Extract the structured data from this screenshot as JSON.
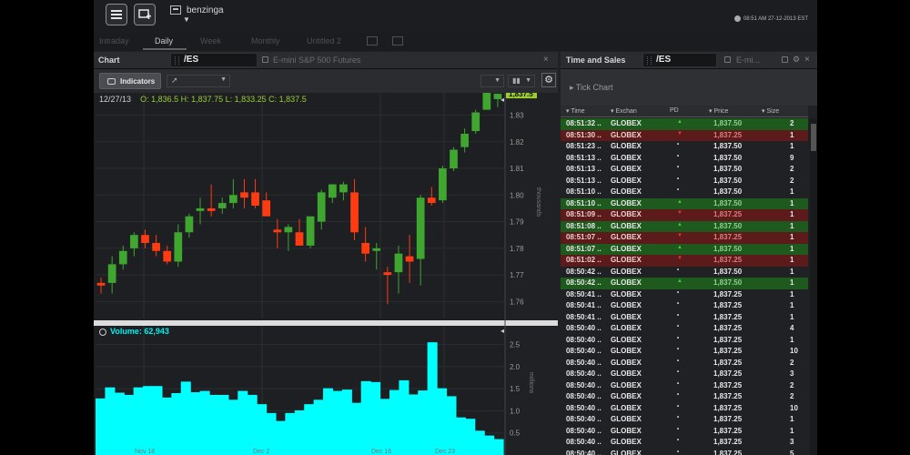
{
  "topbar": {
    "workspace_name": "benzinga",
    "clock": "08:51 AM 27-12-2013 EST"
  },
  "tabs": [
    {
      "label": "Intraday",
      "active": false
    },
    {
      "label": "Daily",
      "active": true
    },
    {
      "label": "Week",
      "active": false
    },
    {
      "label": "Monthly",
      "active": false
    },
    {
      "label": "Untitled 2",
      "active": false
    }
  ],
  "chart_panel": {
    "title": "Chart",
    "symbol": "/ES",
    "description": "E-mini S&P 500 Futures",
    "indicators_label": "Indicators",
    "ohlc_date": "12/27/13",
    "ohlc": "O: 1,836.5 H: 1,837.75 L: 1,833.25 C: 1,837.5",
    "last_price_tag": "1,837.5",
    "volume_label": "Volume:",
    "volume_value": "62,943",
    "price_axis_title": "thousands",
    "volume_axis_title": "millions",
    "x_labels": [
      "Nov 18",
      "Dec 2",
      "Dec 16",
      "Dec 23"
    ]
  },
  "ts_panel": {
    "title": "Time and Sales",
    "symbol": "/ES",
    "description": "E-mi...",
    "tick_chart_label": "Tick Chart",
    "columns": {
      "time": "Time",
      "exch": "Exchan",
      "pd": "PD",
      "price": "Price",
      "size": "Size"
    },
    "rows": [
      {
        "time": "08:51:32 ..",
        "exch": "GLOBEX",
        "pd": "up",
        "price": "1,837.50",
        "size": "2",
        "hl": "g"
      },
      {
        "time": "08:51:30 ..",
        "exch": "GLOBEX",
        "pd": "down",
        "price": "1,837.25",
        "size": "1",
        "hl": "r"
      },
      {
        "time": "08:51:23 ..",
        "exch": "GLOBEX",
        "pd": "dot",
        "price": "1,837.50",
        "size": "1",
        "hl": ""
      },
      {
        "time": "08:51:13 ..",
        "exch": "GLOBEX",
        "pd": "dot",
        "price": "1,837.50",
        "size": "9",
        "hl": ""
      },
      {
        "time": "08:51:13 ..",
        "exch": "GLOBEX",
        "pd": "dot",
        "price": "1,837.50",
        "size": "2",
        "hl": ""
      },
      {
        "time": "08:51:13 ..",
        "exch": "GLOBEX",
        "pd": "dot",
        "price": "1,837.50",
        "size": "2",
        "hl": ""
      },
      {
        "time": "08:51:10 ..",
        "exch": "GLOBEX",
        "pd": "dot",
        "price": "1,837.50",
        "size": "1",
        "hl": ""
      },
      {
        "time": "08:51:10 ..",
        "exch": "GLOBEX",
        "pd": "up",
        "price": "1,837.50",
        "size": "1",
        "hl": "g"
      },
      {
        "time": "08:51:09 ..",
        "exch": "GLOBEX",
        "pd": "down",
        "price": "1,837.25",
        "size": "1",
        "hl": "r"
      },
      {
        "time": "08:51:08 ..",
        "exch": "GLOBEX",
        "pd": "up",
        "price": "1,837.50",
        "size": "1",
        "hl": "g"
      },
      {
        "time": "08:51:07 ..",
        "exch": "GLOBEX",
        "pd": "down",
        "price": "1,837.25",
        "size": "1",
        "hl": "r"
      },
      {
        "time": "08:51:07 ..",
        "exch": "GLOBEX",
        "pd": "up",
        "price": "1,837.50",
        "size": "1",
        "hl": "g"
      },
      {
        "time": "08:51:02 ..",
        "exch": "GLOBEX",
        "pd": "down",
        "price": "1,837.25",
        "size": "1",
        "hl": "r"
      },
      {
        "time": "08:50:42 ..",
        "exch": "GLOBEX",
        "pd": "dot",
        "price": "1,837.50",
        "size": "1",
        "hl": ""
      },
      {
        "time": "08:50:42 ..",
        "exch": "GLOBEX",
        "pd": "up",
        "price": "1,837.50",
        "size": "1",
        "hl": "g"
      },
      {
        "time": "08:50:41 ..",
        "exch": "GLOBEX",
        "pd": "dot",
        "price": "1,837.25",
        "size": "1",
        "hl": ""
      },
      {
        "time": "08:50:41 ..",
        "exch": "GLOBEX",
        "pd": "dot",
        "price": "1,837.25",
        "size": "1",
        "hl": ""
      },
      {
        "time": "08:50:41 ..",
        "exch": "GLOBEX",
        "pd": "dot",
        "price": "1,837.25",
        "size": "1",
        "hl": ""
      },
      {
        "time": "08:50:40 ..",
        "exch": "GLOBEX",
        "pd": "dot",
        "price": "1,837.25",
        "size": "4",
        "hl": ""
      },
      {
        "time": "08:50:40 ..",
        "exch": "GLOBEX",
        "pd": "dot",
        "price": "1,837.25",
        "size": "1",
        "hl": ""
      },
      {
        "time": "08:50:40 ..",
        "exch": "GLOBEX",
        "pd": "dot",
        "price": "1,837.25",
        "size": "10",
        "hl": ""
      },
      {
        "time": "08:50:40 ..",
        "exch": "GLOBEX",
        "pd": "dot",
        "price": "1,837.25",
        "size": "2",
        "hl": ""
      },
      {
        "time": "08:50:40 ..",
        "exch": "GLOBEX",
        "pd": "dot",
        "price": "1,837.25",
        "size": "3",
        "hl": ""
      },
      {
        "time": "08:50:40 ..",
        "exch": "GLOBEX",
        "pd": "dot",
        "price": "1,837.25",
        "size": "2",
        "hl": ""
      },
      {
        "time": "08:50:40 ..",
        "exch": "GLOBEX",
        "pd": "dot",
        "price": "1,837.25",
        "size": "2",
        "hl": ""
      },
      {
        "time": "08:50:40 ..",
        "exch": "GLOBEX",
        "pd": "dot",
        "price": "1,837.25",
        "size": "10",
        "hl": ""
      },
      {
        "time": "08:50:40 ..",
        "exch": "GLOBEX",
        "pd": "dot",
        "price": "1,837.25",
        "size": "1",
        "hl": ""
      },
      {
        "time": "08:50:40 ..",
        "exch": "GLOBEX",
        "pd": "dot",
        "price": "1,837.25",
        "size": "1",
        "hl": ""
      },
      {
        "time": "08:50:40 ..",
        "exch": "GLOBEX",
        "pd": "dot",
        "price": "1,837.25",
        "size": "3",
        "hl": ""
      },
      {
        "time": "08:50:40 ..",
        "exch": "GLOBEX",
        "pd": "dot",
        "price": "1,837.25",
        "size": "5",
        "hl": ""
      }
    ]
  },
  "colors": {
    "up": "#3fa62f",
    "down": "#ff3b12",
    "volume": "#00ffff",
    "bg": "#1f2124"
  },
  "chart_data": [
    {
      "type": "candlestick",
      "title": "/ES",
      "ylim": [
        1755,
        1837
      ],
      "yticks": [
        1.76,
        1.77,
        1.78,
        1.79,
        1.8,
        1.81,
        1.82,
        1.83
      ],
      "y_tick_labels": [
        "1.76",
        "1.77",
        "1.78",
        "1.79",
        "1.80",
        "1.81",
        "1.82",
        "1.83"
      ],
      "candles": [
        {
          "o": 1767,
          "h": 1769,
          "l": 1763,
          "c": 1766
        },
        {
          "o": 1767,
          "h": 1777,
          "l": 1763,
          "c": 1774
        },
        {
          "o": 1774,
          "h": 1781,
          "l": 1772,
          "c": 1779
        },
        {
          "o": 1780,
          "h": 1786,
          "l": 1777,
          "c": 1785
        },
        {
          "o": 1785,
          "h": 1787,
          "l": 1780,
          "c": 1782
        },
        {
          "o": 1782,
          "h": 1785,
          "l": 1777,
          "c": 1779
        },
        {
          "o": 1779,
          "h": 1781,
          "l": 1774,
          "c": 1775
        },
        {
          "o": 1775,
          "h": 1789,
          "l": 1773,
          "c": 1786
        },
        {
          "o": 1786,
          "h": 1793,
          "l": 1784,
          "c": 1792
        },
        {
          "o": 1794,
          "h": 1799,
          "l": 1789,
          "c": 1795
        },
        {
          "o": 1795,
          "h": 1804,
          "l": 1792,
          "c": 1794
        },
        {
          "o": 1795,
          "h": 1799,
          "l": 1793,
          "c": 1797
        },
        {
          "o": 1797,
          "h": 1806,
          "l": 1795,
          "c": 1800
        },
        {
          "o": 1801,
          "h": 1806,
          "l": 1795,
          "c": 1799
        },
        {
          "o": 1801,
          "h": 1806,
          "l": 1795,
          "c": 1796
        },
        {
          "o": 1798,
          "h": 1801,
          "l": 1794,
          "c": 1792
        },
        {
          "o": 1787,
          "h": 1791,
          "l": 1780,
          "c": 1786
        },
        {
          "o": 1786,
          "h": 1789,
          "l": 1779,
          "c": 1788
        },
        {
          "o": 1786,
          "h": 1791,
          "l": 1782,
          "c": 1781
        },
        {
          "o": 1781,
          "h": 1791,
          "l": 1780,
          "c": 1792
        },
        {
          "o": 1790,
          "h": 1802,
          "l": 1787,
          "c": 1801
        },
        {
          "o": 1799,
          "h": 1804,
          "l": 1797,
          "c": 1804
        },
        {
          "o": 1801,
          "h": 1805,
          "l": 1798,
          "c": 1804
        },
        {
          "o": 1801,
          "h": 1806,
          "l": 1783,
          "c": 1786
        },
        {
          "o": 1782,
          "h": 1788,
          "l": 1775,
          "c": 1778
        },
        {
          "o": 1779,
          "h": 1782,
          "l": 1772,
          "c": 1780
        },
        {
          "o": 1771,
          "h": 1773,
          "l": 1759,
          "c": 1770
        },
        {
          "o": 1771,
          "h": 1781,
          "l": 1763,
          "c": 1778
        },
        {
          "o": 1777,
          "h": 1785,
          "l": 1767,
          "c": 1775
        },
        {
          "o": 1776,
          "h": 1800,
          "l": 1766,
          "c": 1799
        },
        {
          "o": 1799,
          "h": 1803,
          "l": 1796,
          "c": 1797
        },
        {
          "o": 1798,
          "h": 1811,
          "l": 1797,
          "c": 1810
        },
        {
          "o": 1810,
          "h": 1818,
          "l": 1809,
          "c": 1817
        },
        {
          "o": 1818,
          "h": 1825,
          "l": 1816,
          "c": 1823
        },
        {
          "o": 1824,
          "h": 1832,
          "l": 1823,
          "c": 1831
        },
        {
          "o": 1832,
          "h": 1840,
          "l": 1832,
          "c": 1839
        },
        {
          "o": 1836,
          "h": 1838,
          "l": 1833,
          "c": 1838
        }
      ]
    },
    {
      "type": "bar",
      "title": "Volume",
      "ylabel": "millions",
      "ylim": [
        0,
        2.8
      ],
      "yticks": [
        0.5,
        1.0,
        1.5,
        2.0,
        2.5
      ],
      "y_tick_labels": [
        "0.5",
        "1.0",
        "1.5",
        "2.0",
        "2.5"
      ],
      "values": [
        1.28,
        1.53,
        1.41,
        1.36,
        1.53,
        1.56,
        1.56,
        1.3,
        1.4,
        1.66,
        1.42,
        1.45,
        1.36,
        1.36,
        1.25,
        1.45,
        1.36,
        1.15,
        0.95,
        0.77,
        0.95,
        1.01,
        1.15,
        1.25,
        1.51,
        1.45,
        1.48,
        1.18,
        1.67,
        1.65,
        1.27,
        1.47,
        1.69,
        1.37,
        1.46,
        2.55,
        1.51,
        1.33,
        0.85,
        0.82,
        0.55,
        0.44,
        0.36
      ]
    }
  ]
}
